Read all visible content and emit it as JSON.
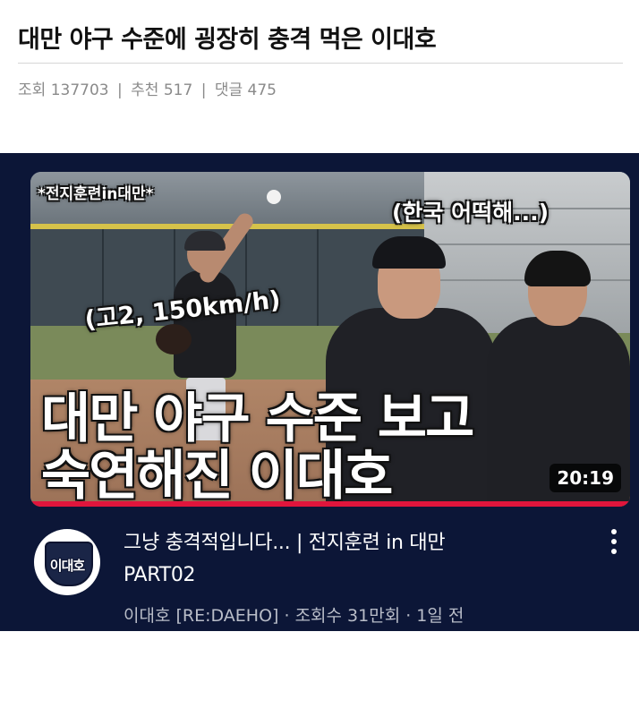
{
  "post": {
    "title": "대만 야구 수준에 굉장히 충격 먹은 이대호",
    "views_label": "조회",
    "views": "137703",
    "recommend_label": "추천",
    "recommend": "517",
    "comments_label": "댓글",
    "comments": "475",
    "separator": "|"
  },
  "video": {
    "thumbnail": {
      "overlay_top": "*전지훈련in대만*",
      "overlay_korea": "(한국 어떡해...)",
      "overlay_speed": "(고2, 150km/h)",
      "overlay_main_line1": "대만 야구 수준 보고",
      "overlay_main_line2": "숙연해진 이대호",
      "duration": "20:19"
    },
    "channel_logo_text": "이대호",
    "title_line1": "그냥 충격적입니다... | 전지훈련 in 대만",
    "title_line2": "PART02",
    "meta": "이대호 [RE:DAEHO] · 조회수 31만회 · 1일 전",
    "menu_icon": "more-vert-icon",
    "accent_color": "#e0153c",
    "background_color": "#0c1637"
  }
}
